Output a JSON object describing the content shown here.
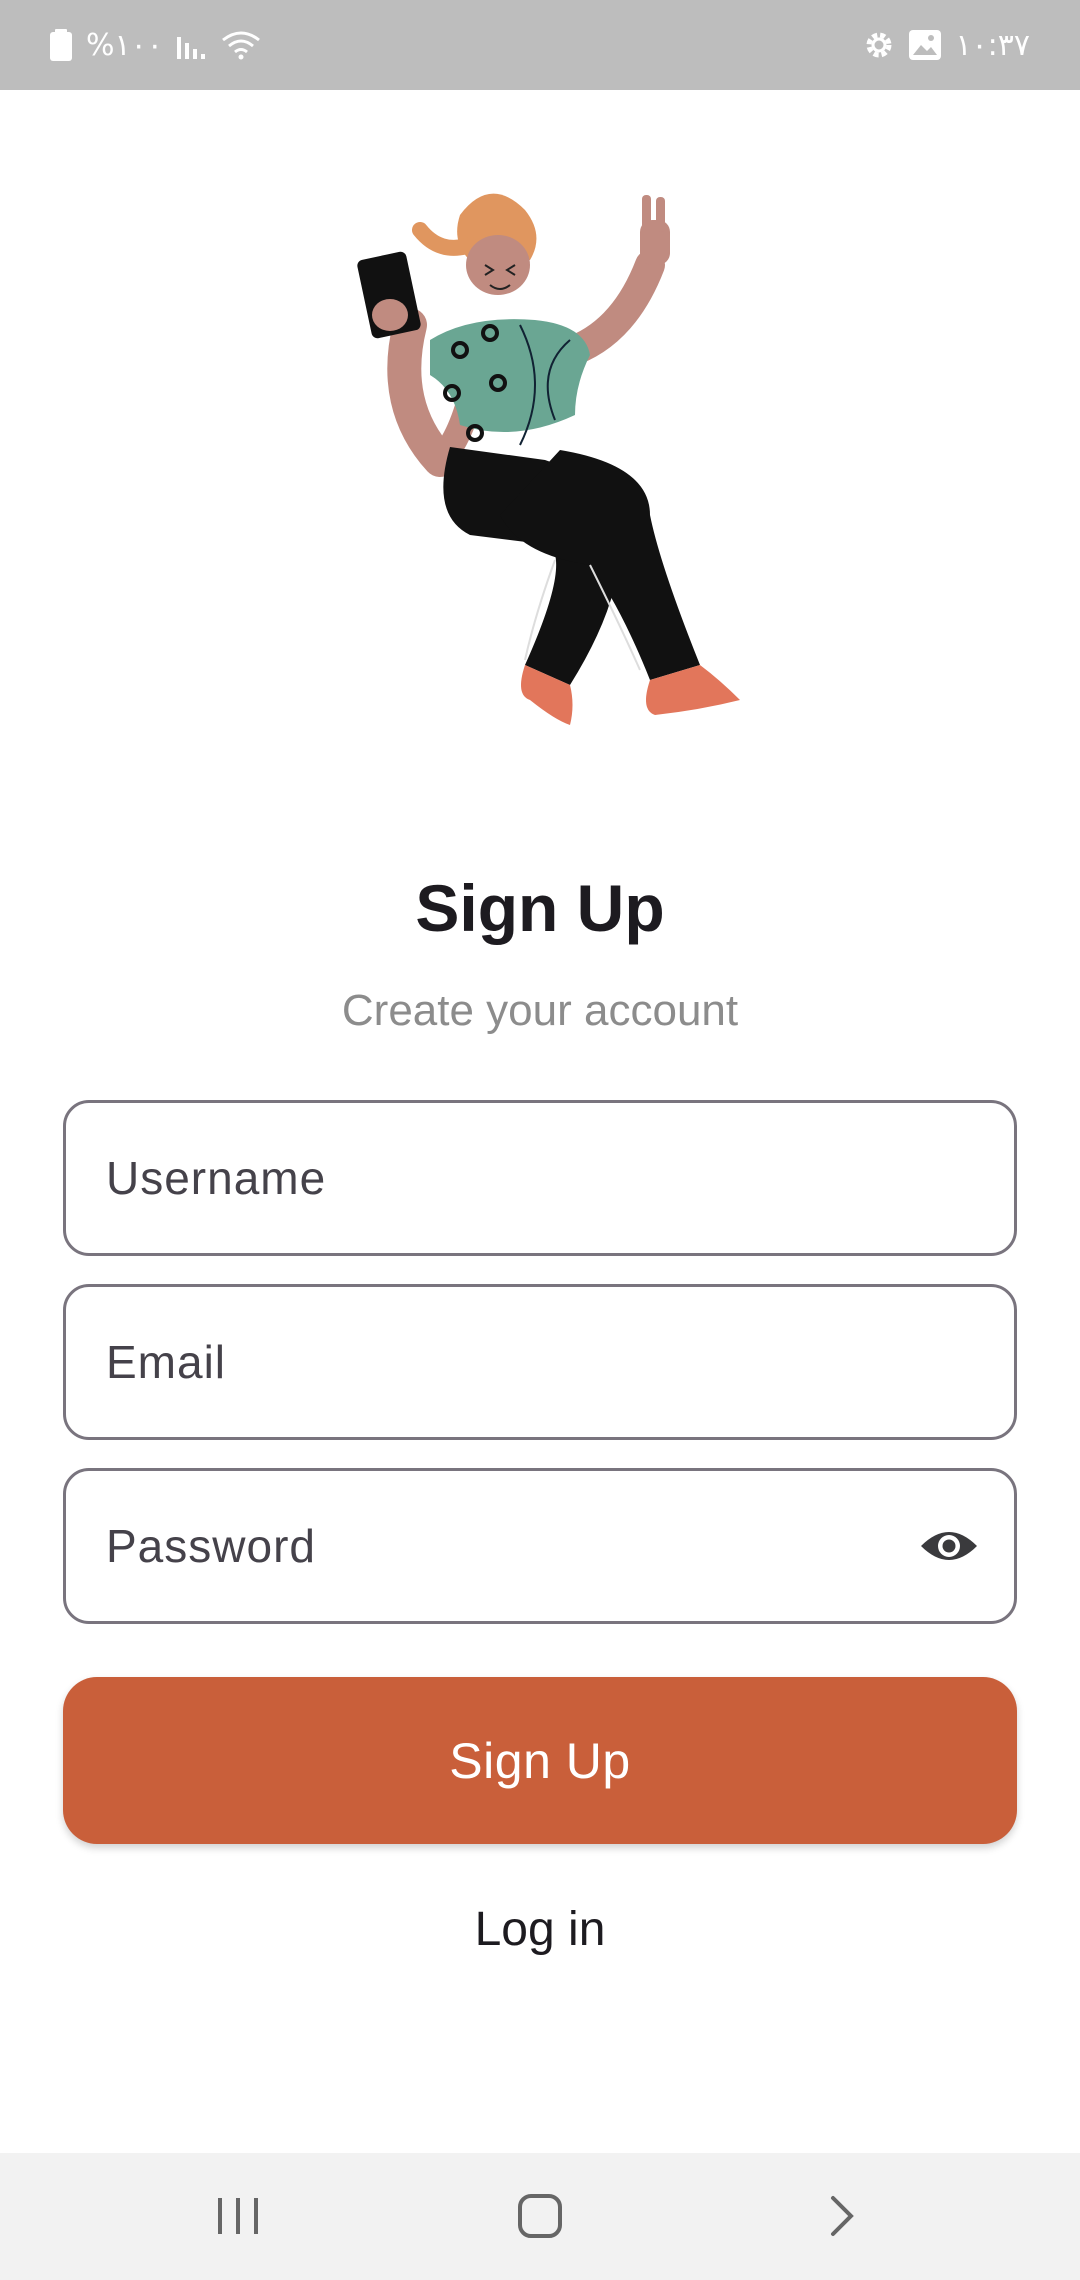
{
  "status_bar": {
    "battery_text": "%۱۰۰",
    "time": "۱۰:۳۷"
  },
  "illustration": {
    "name": "person-with-phone-illustration",
    "colors": {
      "shirt": "#6aa693",
      "pants": "#111111",
      "skin": "#c08b80",
      "hair": "#e0965f",
      "shoes": "#e2765b"
    }
  },
  "header": {
    "title": "Sign Up",
    "subtitle": "Create your account"
  },
  "form": {
    "username_placeholder": "Username",
    "email_placeholder": "Email",
    "password_placeholder": "Password",
    "username_value": "",
    "email_value": "",
    "password_value": ""
  },
  "actions": {
    "signup_label": "Sign Up",
    "login_label": "Log in"
  },
  "colors": {
    "accent": "#c95f3a",
    "status_bar": "#bdbdbd",
    "field_border": "#79747e",
    "subtitle": "#8c8c8c"
  },
  "icons": {
    "password_toggle": "eye-icon",
    "nav": [
      "recents-icon",
      "home-icon",
      "back-icon"
    ]
  }
}
